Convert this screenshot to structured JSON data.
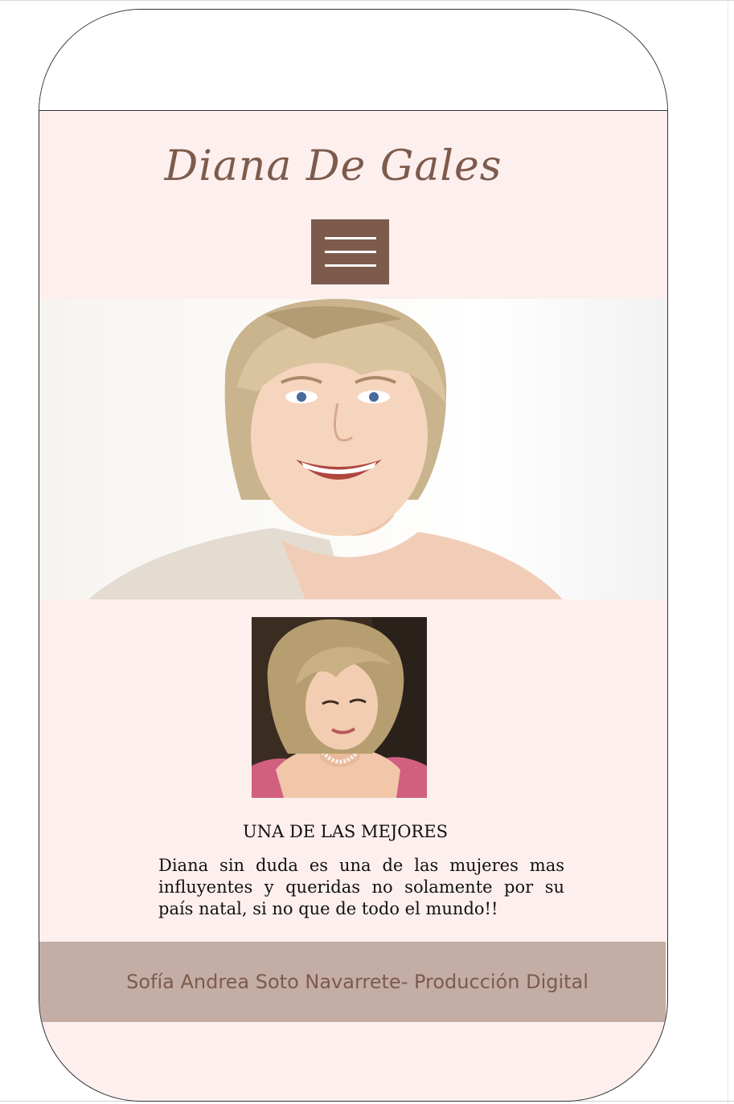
{
  "header": {
    "title": "Diana De Gales",
    "menu_icon": "hamburger-menu-icon"
  },
  "hero": {
    "image_name": "hero-portrait"
  },
  "thumbnail": {
    "image_name": "thumbnail-portrait"
  },
  "content": {
    "heading": "UNA DE LAS MEJORES",
    "paragraph": "Diana sin duda es una de las mujeres mas influyentes y queridas no solamente por su país natal, si no que de todo el mundo!!"
  },
  "footer": {
    "credit": "Sofía Andrea Soto Navarrete- Producción Digital"
  },
  "colors": {
    "background": "#fcefee",
    "accent_brown": "#7d5b4c",
    "footer_bg": "#c4ada5"
  }
}
